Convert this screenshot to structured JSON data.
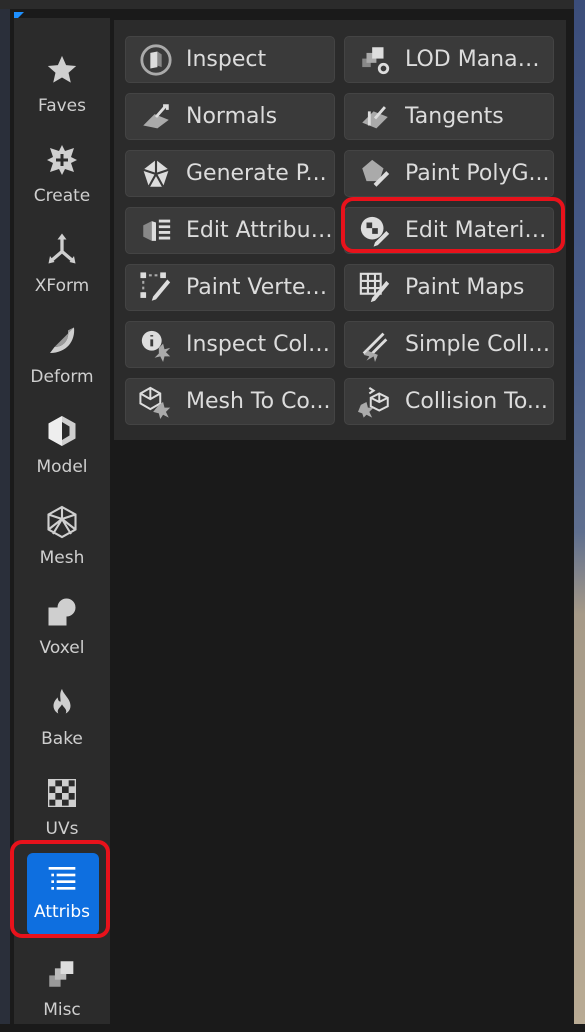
{
  "sidebar": {
    "items": [
      {
        "label": "Faves",
        "icon": "star-icon"
      },
      {
        "label": "Create",
        "icon": "create-icon"
      },
      {
        "label": "XForm",
        "icon": "xform-icon"
      },
      {
        "label": "Deform",
        "icon": "deform-icon"
      },
      {
        "label": "Model",
        "icon": "model-icon"
      },
      {
        "label": "Mesh",
        "icon": "mesh-icon"
      },
      {
        "label": "Voxel",
        "icon": "voxel-icon"
      },
      {
        "label": "Bake",
        "icon": "flame-icon"
      },
      {
        "label": "UVs",
        "icon": "checker-icon"
      },
      {
        "label": "Attribs",
        "icon": "list-icon",
        "active": true
      },
      {
        "label": "Misc",
        "icon": "misc-icon"
      }
    ]
  },
  "tools": {
    "items": [
      {
        "label": "Inspect",
        "icon": "inspect-icon"
      },
      {
        "label": "LOD Manager",
        "icon": "lod-manager-icon"
      },
      {
        "label": "Normals",
        "icon": "normals-icon"
      },
      {
        "label": "Tangents",
        "icon": "tangents-icon"
      },
      {
        "label": "Generate P...",
        "icon": "generate-polygroups-icon"
      },
      {
        "label": "Paint PolyG...",
        "icon": "paint-polygroups-icon"
      },
      {
        "label": "Edit Attribut...",
        "icon": "edit-attributes-icon"
      },
      {
        "label": "Edit Materials",
        "icon": "edit-materials-icon",
        "highlighted": true
      },
      {
        "label": "Paint Vertex...",
        "icon": "paint-vertex-icon"
      },
      {
        "label": "Paint Maps",
        "icon": "paint-maps-icon"
      },
      {
        "label": "Inspect Coll...",
        "icon": "inspect-collision-icon"
      },
      {
        "label": "Simple Colli...",
        "icon": "simple-collision-icon"
      },
      {
        "label": "Mesh To Co...",
        "icon": "mesh-to-collision-icon"
      },
      {
        "label": "Collision To...",
        "icon": "collision-to-mesh-icon"
      }
    ]
  },
  "colors": {
    "accent": "#0e6fe0",
    "highlight": "#e8121b",
    "panel": "#2b2b2b",
    "button": "#3a3a3a"
  }
}
